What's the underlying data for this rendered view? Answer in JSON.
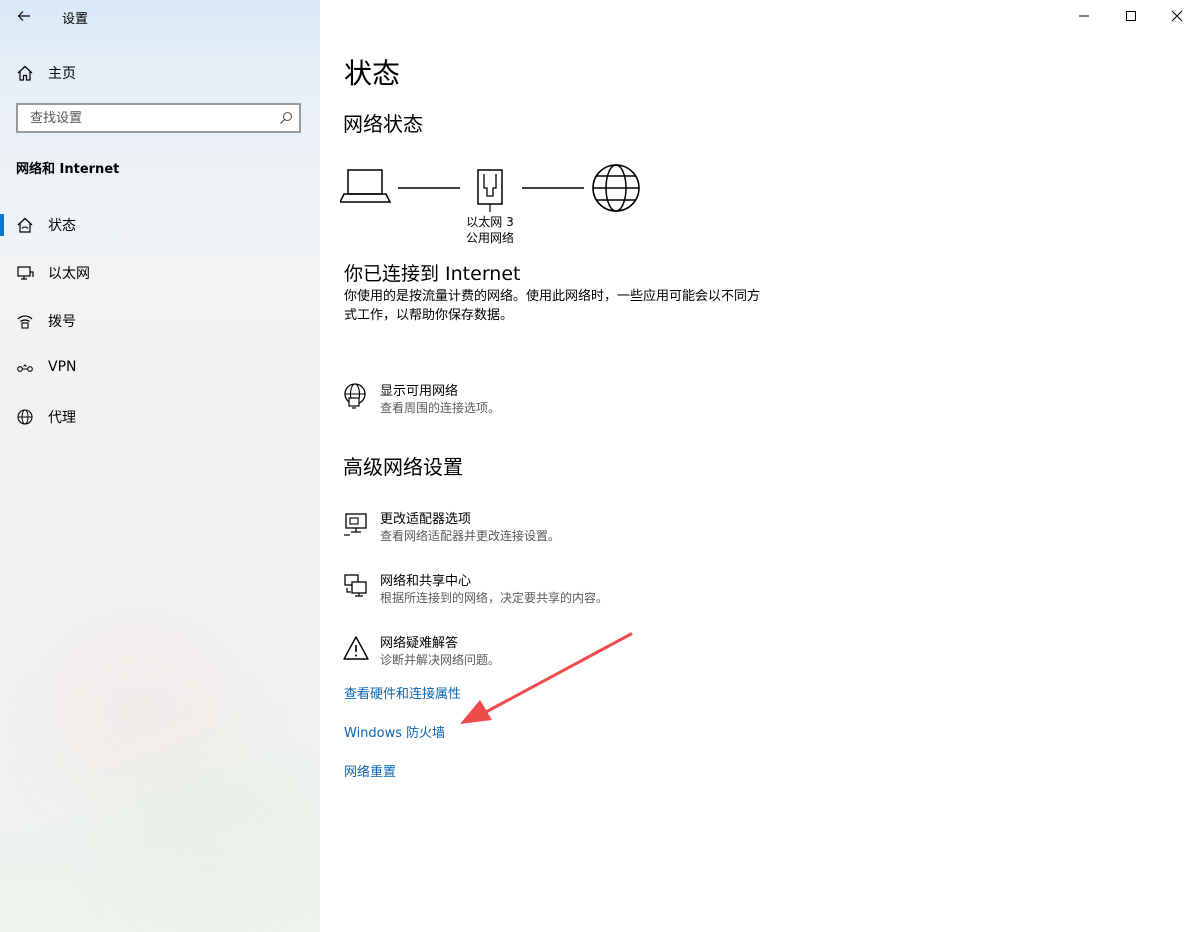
{
  "window": {
    "title": "设置",
    "controls": {
      "minimize": "—",
      "maximize": "☐",
      "close": "✕"
    }
  },
  "sidebar": {
    "home_label": "主页",
    "search_placeholder": "查找设置",
    "section_label": "网络和 Internet",
    "items": [
      {
        "label": "状态",
        "icon": "house-icon",
        "selected": true
      },
      {
        "label": "以太网",
        "icon": "monitor-icon",
        "selected": false
      },
      {
        "label": "拨号",
        "icon": "dial-icon",
        "selected": false
      },
      {
        "label": "VPN",
        "icon": "vpn-icon",
        "selected": false
      },
      {
        "label": "代理",
        "icon": "globe-icon",
        "selected": false
      }
    ]
  },
  "main": {
    "page_title": "状态",
    "network_status_heading": "网络状态",
    "diagram": {
      "adapter_name": "以太网 3",
      "network_type": "公用网络"
    },
    "connection": {
      "title": "你已连接到 Internet",
      "description": "你使用的是按流量计费的网络。使用此网络时，一些应用可能会以不同方式工作，以帮助你保存数据。"
    },
    "show_networks": {
      "title": "显示可用网络",
      "description": "查看周围的连接选项。"
    },
    "advanced_heading": "高级网络设置",
    "advanced_options": [
      {
        "title": "更改适配器选项",
        "description": "查看网络适配器并更改连接设置。",
        "icon": "adapter-icon"
      },
      {
        "title": "网络和共享中心",
        "description": "根据所连接到的网络，决定要共享的内容。",
        "icon": "sharing-icon"
      },
      {
        "title": "网络疑难解答",
        "description": "诊断并解决网络问题。",
        "icon": "warning-icon"
      }
    ],
    "links": [
      {
        "label": "查看硬件和连接属性"
      },
      {
        "label": "Windows 防火墙"
      },
      {
        "label": "网络重置"
      }
    ]
  },
  "colors": {
    "accent": "#0078d7",
    "link": "#0a65b0",
    "annotation_arrow": "#f04b4b"
  }
}
